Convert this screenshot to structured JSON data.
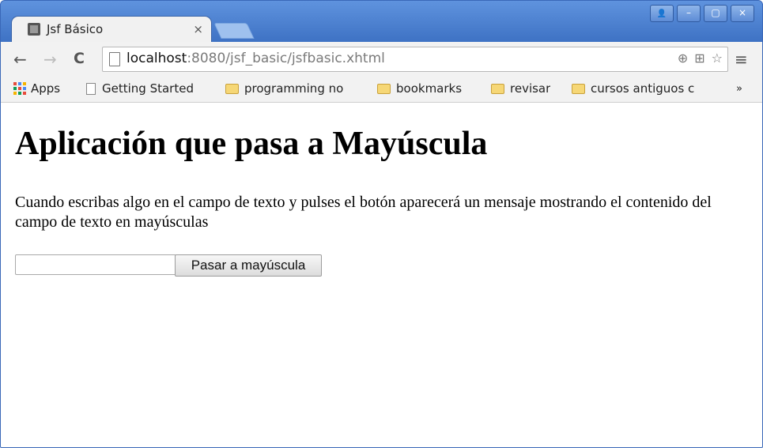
{
  "browser": {
    "tab": {
      "title": "Jsf Básico",
      "close": "×"
    },
    "window_controls": {
      "minimize": "–",
      "restore": "▢",
      "close": "×",
      "profile": "👤"
    },
    "nav": {
      "back": "←",
      "forward": "→",
      "reload": "C",
      "menu": "≡"
    },
    "url": {
      "host": "localhost",
      "rest": ":8080/jsf_basic/jsfbasic.xhtml"
    },
    "bookmarks": {
      "apps": "Apps",
      "items": [
        "Getting Started",
        "programming no",
        "bookmarks",
        "revisar",
        "cursos antiguos c"
      ],
      "overflow": "»"
    }
  },
  "page": {
    "title": "Aplicación que pasa a Mayúscula",
    "description": "Cuando escribas algo en el campo de texto y pulses el botón aparecerá un mensaje mostrando el contenido del campo de texto en mayúsculas",
    "input_value": "",
    "button_label": "Pasar a mayúscula"
  }
}
